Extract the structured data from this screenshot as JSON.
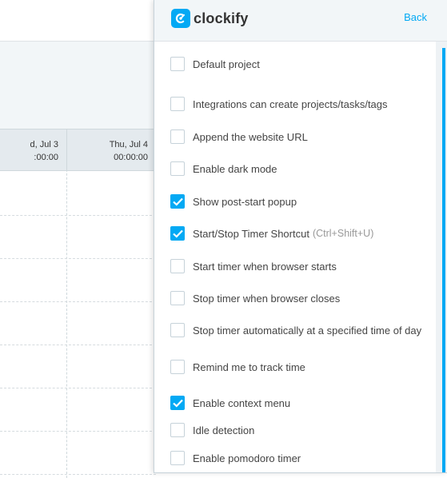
{
  "background": {
    "days": [
      {
        "label": "d, Jul 3",
        "total": ":00:00"
      },
      {
        "label": "Thu, Jul 4",
        "total": "00:00:00"
      }
    ]
  },
  "header": {
    "brand": "clockify",
    "back_label": "Back",
    "accent": "#03a9f4"
  },
  "options": [
    {
      "label": "Default project",
      "checked": false
    },
    {
      "label": "Integrations can create projects/tasks/tags",
      "checked": false
    },
    {
      "label": "Append the website URL",
      "checked": false
    },
    {
      "label": "Enable dark mode",
      "checked": false
    },
    {
      "label": "Show post-start popup",
      "checked": true
    },
    {
      "label": "Start/Stop Timer Shortcut",
      "hint": "(Ctrl+Shift+U)",
      "checked": true
    },
    {
      "label": "Start timer when browser starts",
      "checked": false
    },
    {
      "label": "Stop timer when browser closes",
      "checked": false
    },
    {
      "label": "Stop timer automatically at a specified time of day",
      "checked": false
    },
    {
      "label": "Remind me to track time",
      "checked": false
    },
    {
      "label": "Enable context menu",
      "checked": true
    },
    {
      "label": "Idle detection",
      "checked": false
    },
    {
      "label": "Enable pomodoro timer",
      "checked": false
    }
  ]
}
